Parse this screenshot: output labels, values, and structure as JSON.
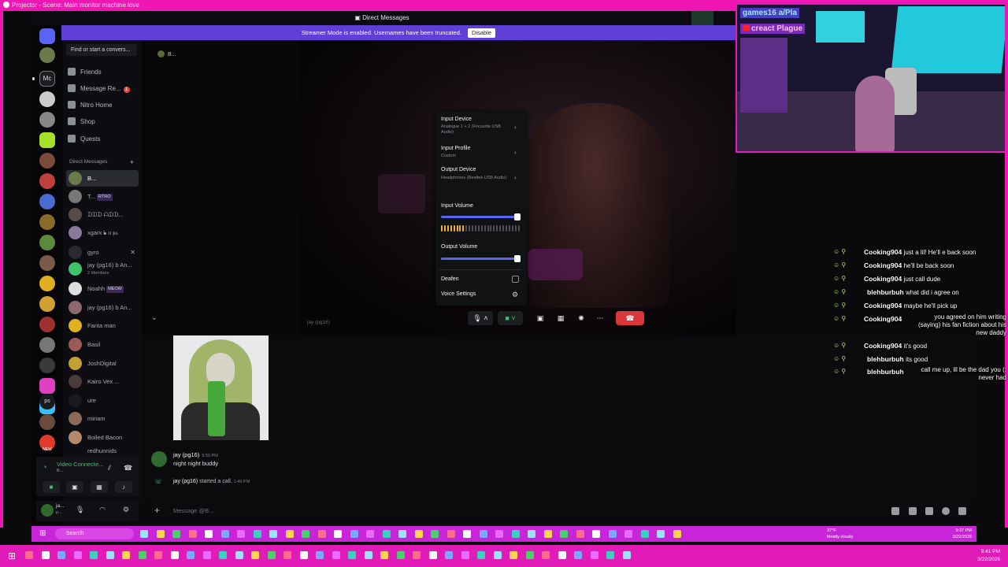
{
  "projector": {
    "title": "Projector - Scene: Main monitor machine love"
  },
  "topbar": {
    "title": "Direct Messages"
  },
  "streamer": {
    "text": "Streamer Mode is enabled. Usernames have been truncated.",
    "disable_label": "Disable"
  },
  "sidebar": {
    "search_placeholder": "Find or start a convers...",
    "nav": [
      {
        "label": "Friends",
        "icon": "friends-icon"
      },
      {
        "label": "Message Re...",
        "icon": "message-requests-icon",
        "badge": "1"
      },
      {
        "label": "Nitro Home",
        "icon": "nitro-icon"
      },
      {
        "label": "Shop",
        "icon": "shop-icon"
      },
      {
        "label": "Quests",
        "icon": "quests-icon"
      }
    ],
    "dm_header": "Direct Messages",
    "dms": [
      {
        "name": "B...",
        "selected": true
      },
      {
        "name": "T...",
        "tag": "RTRO"
      },
      {
        "name": "ᗪᗪᗪ ᗩᗪᗪ..."
      },
      {
        "name": "xgarx ᖲ ⲡ ⲣⲁ"
      },
      {
        "name": "gyro"
      },
      {
        "name": "jay (pg16) b An...",
        "sub": "2 Members"
      },
      {
        "name": "Noahh",
        "tag": "MEOW"
      },
      {
        "name": "jay (pg16) b An..."
      },
      {
        "name": "Fanta man"
      },
      {
        "name": "Basil"
      },
      {
        "name": "JoshDigital"
      },
      {
        "name": "Kairo Vex ..."
      },
      {
        "name": "ure"
      },
      {
        "name": "miriam"
      },
      {
        "name": "Boiled Bacon"
      },
      {
        "name": "redhunnids"
      }
    ]
  },
  "rail": {
    "servers": [
      "dm-home",
      "s1",
      "mc",
      "s3",
      "s4",
      "s5",
      "s6",
      "s7",
      "s8",
      "s9",
      "s10",
      "s11",
      "s12",
      "s13",
      "s14",
      "s15",
      "s16",
      "s17",
      "s18",
      "ps",
      "new"
    ],
    "labels": {
      "mc": "Mc",
      "ps": "ps",
      "new": "NEW",
      "badge_10": "10",
      "badge_285": "285"
    }
  },
  "voice": {
    "status": "Video Connecte...",
    "sub": "B..."
  },
  "user": {
    "name": "ja...",
    "status": "p..."
  },
  "call": {
    "name": "B...",
    "participant_tag": "jay (pg16)"
  },
  "popup": {
    "input_device": "Input Device",
    "input_device_value": "Analogue 1 + 2 (Focusrite USB Audio)",
    "input_profile": "Input Profile",
    "input_profile_value": "Custom",
    "output_device": "Output Device",
    "output_device_value": "Headphones (Realtek USB Audio)",
    "input_volume": "Input Volume",
    "input_volume_level": 0.97,
    "input_meter_level": 0.3,
    "output_volume": "Output Volume",
    "output_volume_level": 0.97,
    "deafen": "Deafen",
    "voice_settings": "Voice Settings"
  },
  "chat": {
    "author": "jay (pg16)",
    "time1": "5:50 PM",
    "message": "night night buddy",
    "sys_author": "jay (pg16)",
    "sys_text": " started a call.",
    "sys_time": "1:40 PM",
    "composer_placeholder": "Message @B..."
  },
  "cam": {
    "label1": "games16 a/Pla",
    "label2": "creact Plague"
  },
  "stream_chat": [
    {
      "user": "Cooking904",
      "text": "just a lil! He'll e back soon"
    },
    {
      "user": "Cooking904",
      "text": "he'll be back soon"
    },
    {
      "user": "Cooking904",
      "text": "just call dude"
    },
    {
      "user": "blehburbuh",
      "text": "what did i agree on"
    },
    {
      "user": "Cooking904",
      "text": "maybe he'll pick up"
    },
    {
      "user": "Cooking904",
      "text": "you agreed on him writing (saying) his fan fiction about his new daddy"
    },
    {
      "user": "Cooking904",
      "text": "it's good"
    },
    {
      "user": "blehburbuh",
      "text": "its good"
    },
    {
      "user": "blehburbuh",
      "text": "call me up, ill be the dad you (: never had"
    }
  ],
  "taskbar_inner": {
    "search": "Search",
    "weather_temp": "37°F",
    "weather_desc": "Mostly cloudy",
    "time": "9:37 PM",
    "date": "3/22/2026"
  },
  "taskbar_outer": {
    "time": "9:41 PM",
    "date": "3/22/2026"
  },
  "colors": {
    "pink_frame": "#f016b4",
    "streamer_bar": "#5f3fd8",
    "hangup": "#da373c",
    "slider": "#5865f2",
    "meter": "#f0b232",
    "voice_green": "#3ec26e"
  }
}
